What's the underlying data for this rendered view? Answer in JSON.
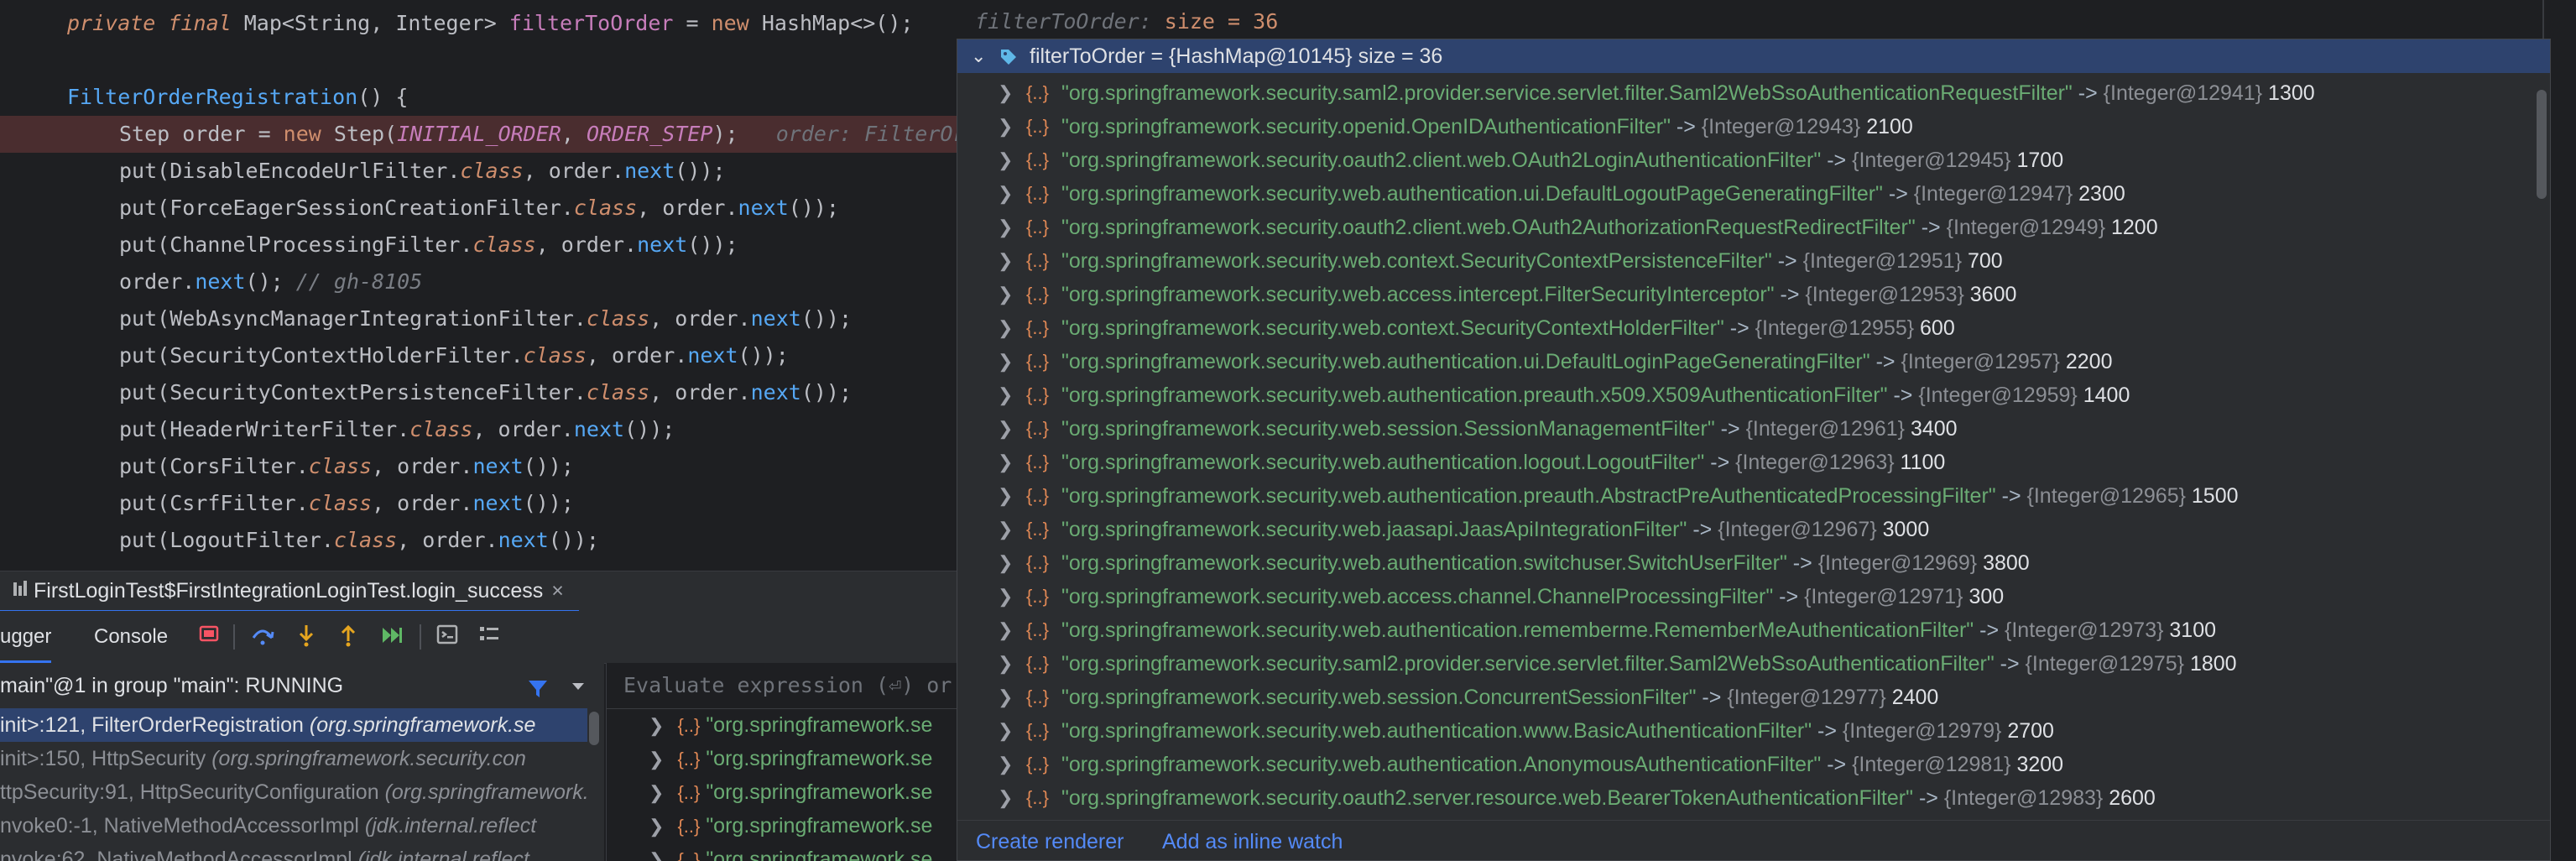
{
  "editor": {
    "lines": [
      {
        "tokens": [
          [
            "kwi",
            "private final "
          ],
          [
            "plain",
            "Map<String, Integer> "
          ],
          [
            "fld",
            "filterToOrder"
          ],
          [
            "plain",
            " = "
          ],
          [
            "kw",
            "new "
          ],
          [
            "plain",
            "HashMap<>();"
          ]
        ]
      },
      {
        "tokens": []
      },
      {
        "tokens": [
          [
            "fn",
            "FilterOrderRegistration"
          ],
          [
            "plain",
            "() {"
          ]
        ]
      },
      {
        "tokens": [
          [
            "plain",
            "Step order = "
          ],
          [
            "kw",
            "new "
          ],
          [
            "plain",
            "Step("
          ],
          [
            "cst",
            "INITIAL_ORDER"
          ],
          [
            "plain",
            ", "
          ],
          [
            "cst",
            "ORDER_STEP"
          ],
          [
            "plain",
            ");   "
          ],
          [
            "hint",
            "order: FilterOrderRegistration$Step"
          ]
        ],
        "highlight": true
      },
      {
        "tokens": [
          [
            "plain",
            "put(DisableEncodeUrlFilter."
          ],
          [
            "kwi",
            "class"
          ],
          [
            "plain",
            ", order."
          ],
          [
            "fn",
            "next"
          ],
          [
            "plain",
            "());"
          ]
        ]
      },
      {
        "tokens": [
          [
            "plain",
            "put(ForceEagerSessionCreationFilter."
          ],
          [
            "kwi",
            "class"
          ],
          [
            "plain",
            ", order."
          ],
          [
            "fn",
            "next"
          ],
          [
            "plain",
            "());"
          ]
        ]
      },
      {
        "tokens": [
          [
            "plain",
            "put(ChannelProcessingFilter."
          ],
          [
            "kwi",
            "class"
          ],
          [
            "plain",
            ", order."
          ],
          [
            "fn",
            "next"
          ],
          [
            "plain",
            "());"
          ]
        ]
      },
      {
        "tokens": [
          [
            "plain",
            "order."
          ],
          [
            "fn",
            "next"
          ],
          [
            "plain",
            "(); "
          ],
          [
            "cmt",
            "// gh-8105"
          ]
        ]
      },
      {
        "tokens": [
          [
            "plain",
            "put(WebAsyncManagerIntegrationFilter."
          ],
          [
            "kwi",
            "class"
          ],
          [
            "plain",
            ", order."
          ],
          [
            "fn",
            "next"
          ],
          [
            "plain",
            "());"
          ]
        ]
      },
      {
        "tokens": [
          [
            "plain",
            "put(SecurityContextHolderFilter."
          ],
          [
            "kwi",
            "class"
          ],
          [
            "plain",
            ", order."
          ],
          [
            "fn",
            "next"
          ],
          [
            "plain",
            "());"
          ]
        ]
      },
      {
        "tokens": [
          [
            "plain",
            "put(SecurityContextPersistenceFilter."
          ],
          [
            "kwi",
            "class"
          ],
          [
            "plain",
            ", order."
          ],
          [
            "fn",
            "next"
          ],
          [
            "plain",
            "());"
          ]
        ]
      },
      {
        "tokens": [
          [
            "plain",
            "put(HeaderWriterFilter."
          ],
          [
            "kwi",
            "class"
          ],
          [
            "plain",
            ", order."
          ],
          [
            "fn",
            "next"
          ],
          [
            "plain",
            "());"
          ]
        ]
      },
      {
        "tokens": [
          [
            "plain",
            "put(CorsFilter."
          ],
          [
            "kwi",
            "class"
          ],
          [
            "plain",
            ", order."
          ],
          [
            "fn",
            "next"
          ],
          [
            "plain",
            "());"
          ]
        ]
      },
      {
        "tokens": [
          [
            "plain",
            "put(CsrfFilter."
          ],
          [
            "kwi",
            "class"
          ],
          [
            "plain",
            ", order."
          ],
          [
            "fn",
            "next"
          ],
          [
            "plain",
            "());"
          ]
        ]
      },
      {
        "tokens": [
          [
            "plain",
            "put(LogoutFilter."
          ],
          [
            "kwi",
            "class"
          ],
          [
            "plain",
            ", order."
          ],
          [
            "fn",
            "next"
          ],
          [
            "plain",
            "());"
          ]
        ]
      }
    ],
    "inline_hint_name": "filterToOrder:",
    "inline_hint_value": "size = 36"
  },
  "debug": {
    "tab_title": "FirstLoginTest$FirstIntegrationLoginTest.login_success",
    "tab_close": "×",
    "debugger_tab": "ugger",
    "console_tab": "Console",
    "thread": "main\"@1 in group \"main\": RUNNING",
    "frames": [
      {
        "method": "init>:121, FilterOrderRegistration ",
        "cls": "(org.springframework.se",
        "selected": true
      },
      {
        "method": "init>:150, HttpSecurity ",
        "cls": "(org.springframework.security.con"
      },
      {
        "method": "ttpSecurity:91, HttpSecurityConfiguration ",
        "cls": "(org.springframework.sec"
      },
      {
        "method": "nvoke0:-1, NativeMethodAccessorImpl ",
        "cls": "(jdk.internal.reflect"
      },
      {
        "method": "nvoke:62, NativeMethodAccessorImpl ",
        "cls": "(jdk.internal.reflect"
      }
    ],
    "evaluate_placeholder": "Evaluate expression (⏎) or",
    "var_rows": [
      "\"org.springframework.se",
      "\"org.springframework.se",
      "\"org.springframework.se",
      "\"org.springframework.se",
      "\"org.springframework.se"
    ]
  },
  "popup": {
    "header_name": "filterToOrder",
    "header_value": "= {HashMap@10145}  size = 36",
    "entries": [
      {
        "key": "\"org.springframework.security.saml2.provider.service.servlet.filter.Saml2WebSsoAuthenticationRequestFilter\"",
        "ref": "{Integer@12941}",
        "value": "1300"
      },
      {
        "key": "\"org.springframework.security.openid.OpenIDAuthenticationFilter\"",
        "ref": "{Integer@12943}",
        "value": "2100"
      },
      {
        "key": "\"org.springframework.security.oauth2.client.web.OAuth2LoginAuthenticationFilter\"",
        "ref": "{Integer@12945}",
        "value": "1700"
      },
      {
        "key": "\"org.springframework.security.web.authentication.ui.DefaultLogoutPageGeneratingFilter\"",
        "ref": "{Integer@12947}",
        "value": "2300"
      },
      {
        "key": "\"org.springframework.security.oauth2.client.web.OAuth2AuthorizationRequestRedirectFilter\"",
        "ref": "{Integer@12949}",
        "value": "1200"
      },
      {
        "key": "\"org.springframework.security.web.context.SecurityContextPersistenceFilter\"",
        "ref": "{Integer@12951}",
        "value": "700"
      },
      {
        "key": "\"org.springframework.security.web.access.intercept.FilterSecurityInterceptor\"",
        "ref": "{Integer@12953}",
        "value": "3600"
      },
      {
        "key": "\"org.springframework.security.web.context.SecurityContextHolderFilter\"",
        "ref": "{Integer@12955}",
        "value": "600"
      },
      {
        "key": "\"org.springframework.security.web.authentication.ui.DefaultLoginPageGeneratingFilter\"",
        "ref": "{Integer@12957}",
        "value": "2200"
      },
      {
        "key": "\"org.springframework.security.web.authentication.preauth.x509.X509AuthenticationFilter\"",
        "ref": "{Integer@12959}",
        "value": "1400"
      },
      {
        "key": "\"org.springframework.security.web.session.SessionManagementFilter\"",
        "ref": "{Integer@12961}",
        "value": "3400"
      },
      {
        "key": "\"org.springframework.security.web.authentication.logout.LogoutFilter\"",
        "ref": "{Integer@12963}",
        "value": "1100"
      },
      {
        "key": "\"org.springframework.security.web.authentication.preauth.AbstractPreAuthenticatedProcessingFilter\"",
        "ref": "{Integer@12965}",
        "value": "1500"
      },
      {
        "key": "\"org.springframework.security.web.jaasapi.JaasApiIntegrationFilter\"",
        "ref": "{Integer@12967}",
        "value": "3000"
      },
      {
        "key": "\"org.springframework.security.web.authentication.switchuser.SwitchUserFilter\"",
        "ref": "{Integer@12969}",
        "value": "3800"
      },
      {
        "key": "\"org.springframework.security.web.access.channel.ChannelProcessingFilter\"",
        "ref": "{Integer@12971}",
        "value": "300"
      },
      {
        "key": "\"org.springframework.security.web.authentication.rememberme.RememberMeAuthenticationFilter\"",
        "ref": "{Integer@12973}",
        "value": "3100"
      },
      {
        "key": "\"org.springframework.security.saml2.provider.service.servlet.filter.Saml2WebSsoAuthenticationFilter\"",
        "ref": "{Integer@12975}",
        "value": "1800"
      },
      {
        "key": "\"org.springframework.security.web.session.ConcurrentSessionFilter\"",
        "ref": "{Integer@12977}",
        "value": "2400"
      },
      {
        "key": "\"org.springframework.security.web.authentication.www.BasicAuthenticationFilter\"",
        "ref": "{Integer@12979}",
        "value": "2700"
      },
      {
        "key": "\"org.springframework.security.web.authentication.AnonymousAuthenticationFilter\"",
        "ref": "{Integer@12981}",
        "value": "3200"
      },
      {
        "key": "\"org.springframework.security.oauth2.server.resource.web.BearerTokenAuthenticationFilter\"",
        "ref": "{Integer@12983}",
        "value": "2600"
      }
    ],
    "arrow": "->",
    "footer": {
      "create_renderer": "Create renderer",
      "add_inline_watch": "Add as inline watch"
    }
  },
  "colors": {
    "accent": "#3574f0",
    "selection": "#2e436e",
    "breakpoint_line": "#4a2d2f",
    "string": "#6aab73",
    "link": "#548af7"
  }
}
